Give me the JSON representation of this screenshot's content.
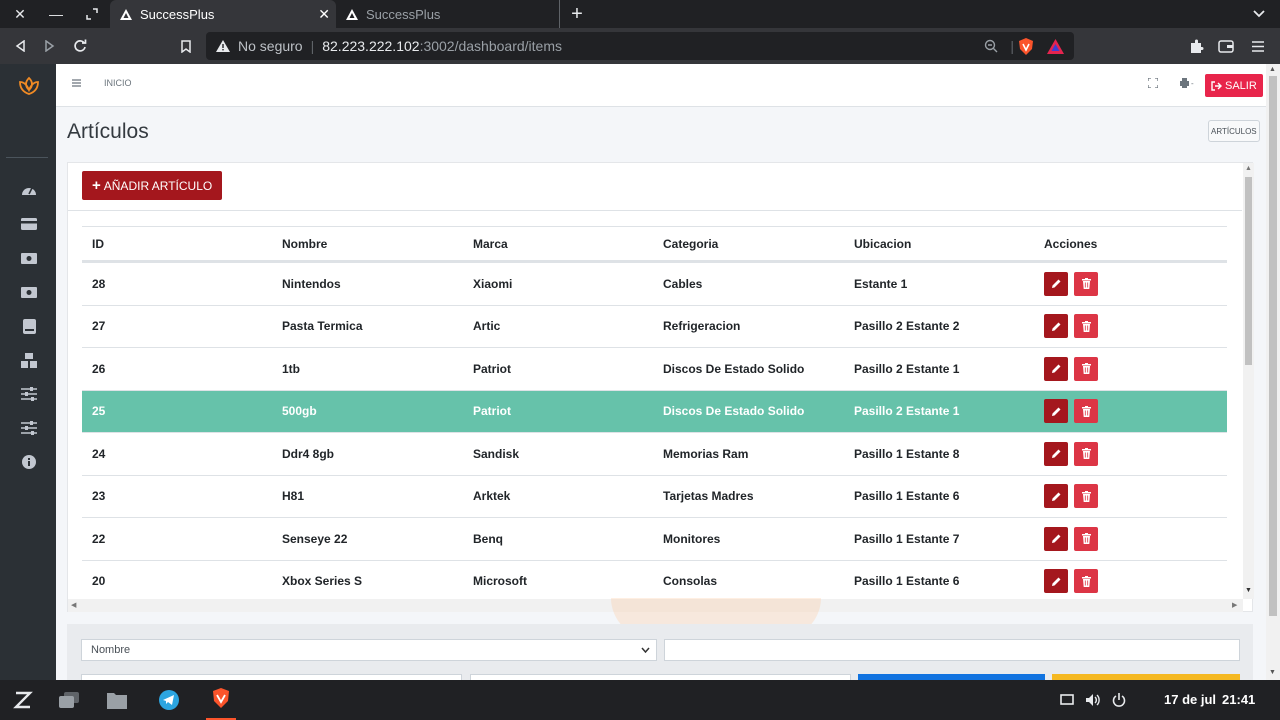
{
  "browser": {
    "tabs": [
      {
        "title": "SuccessPlus",
        "active": true
      },
      {
        "title": "SuccessPlus",
        "active": false
      }
    ],
    "security_label": "No seguro",
    "url_host": "82.223.222.102",
    "url_rest": ":3002/dashboard/items"
  },
  "header": {
    "breadcrumb": "INICIO",
    "logout_label": "SALIR"
  },
  "page": {
    "title": "Artículos",
    "breadcrumb_button": "ARTÍCULOS",
    "add_button_label": "AÑADIR ARTÍCULO"
  },
  "table": {
    "columns": [
      "ID",
      "Nombre",
      "Marca",
      "Categoria",
      "Ubicacion",
      "Acciones"
    ],
    "rows": [
      {
        "id": "28",
        "nombre": "Nintendos",
        "marca": "Xiaomi",
        "categoria": "Cables",
        "ubicacion": "Estante 1"
      },
      {
        "id": "27",
        "nombre": "Pasta Termica",
        "marca": "Artic",
        "categoria": "Refrigeracion",
        "ubicacion": "Pasillo 2 Estante 2"
      },
      {
        "id": "26",
        "nombre": "1tb",
        "marca": "Patriot",
        "categoria": "Discos De Estado Solido",
        "ubicacion": "Pasillo 2 Estante 1"
      },
      {
        "id": "25",
        "nombre": "500gb",
        "marca": "Patriot",
        "categoria": "Discos De Estado Solido",
        "ubicacion": "Pasillo 2 Estante 1",
        "highlighted": true
      },
      {
        "id": "24",
        "nombre": "Ddr4 8gb",
        "marca": "Sandisk",
        "categoria": "Memorias Ram",
        "ubicacion": "Pasillo 1 Estante 8"
      },
      {
        "id": "23",
        "nombre": "H81",
        "marca": "Arktek",
        "categoria": "Tarjetas Madres",
        "ubicacion": "Pasillo 1 Estante 6"
      },
      {
        "id": "22",
        "nombre": "Senseye 22",
        "marca": "Benq",
        "categoria": "Monitores",
        "ubicacion": "Pasillo 1 Estante 7"
      },
      {
        "id": "20",
        "nombre": "Xbox Series S",
        "marca": "Microsoft",
        "categoria": "Consolas",
        "ubicacion": "Pasillo 1 Estante 6"
      }
    ],
    "highlight_color": "#66c2aa"
  },
  "filter": {
    "field_selected": "Nombre"
  },
  "taskbar": {
    "date": "17 de jul",
    "time": "21:41"
  },
  "colors": {
    "brand_red": "#a4171d",
    "logout_red": "#e8254b",
    "delete_red": "#dc3545",
    "logo_orange": "#f08a24"
  }
}
